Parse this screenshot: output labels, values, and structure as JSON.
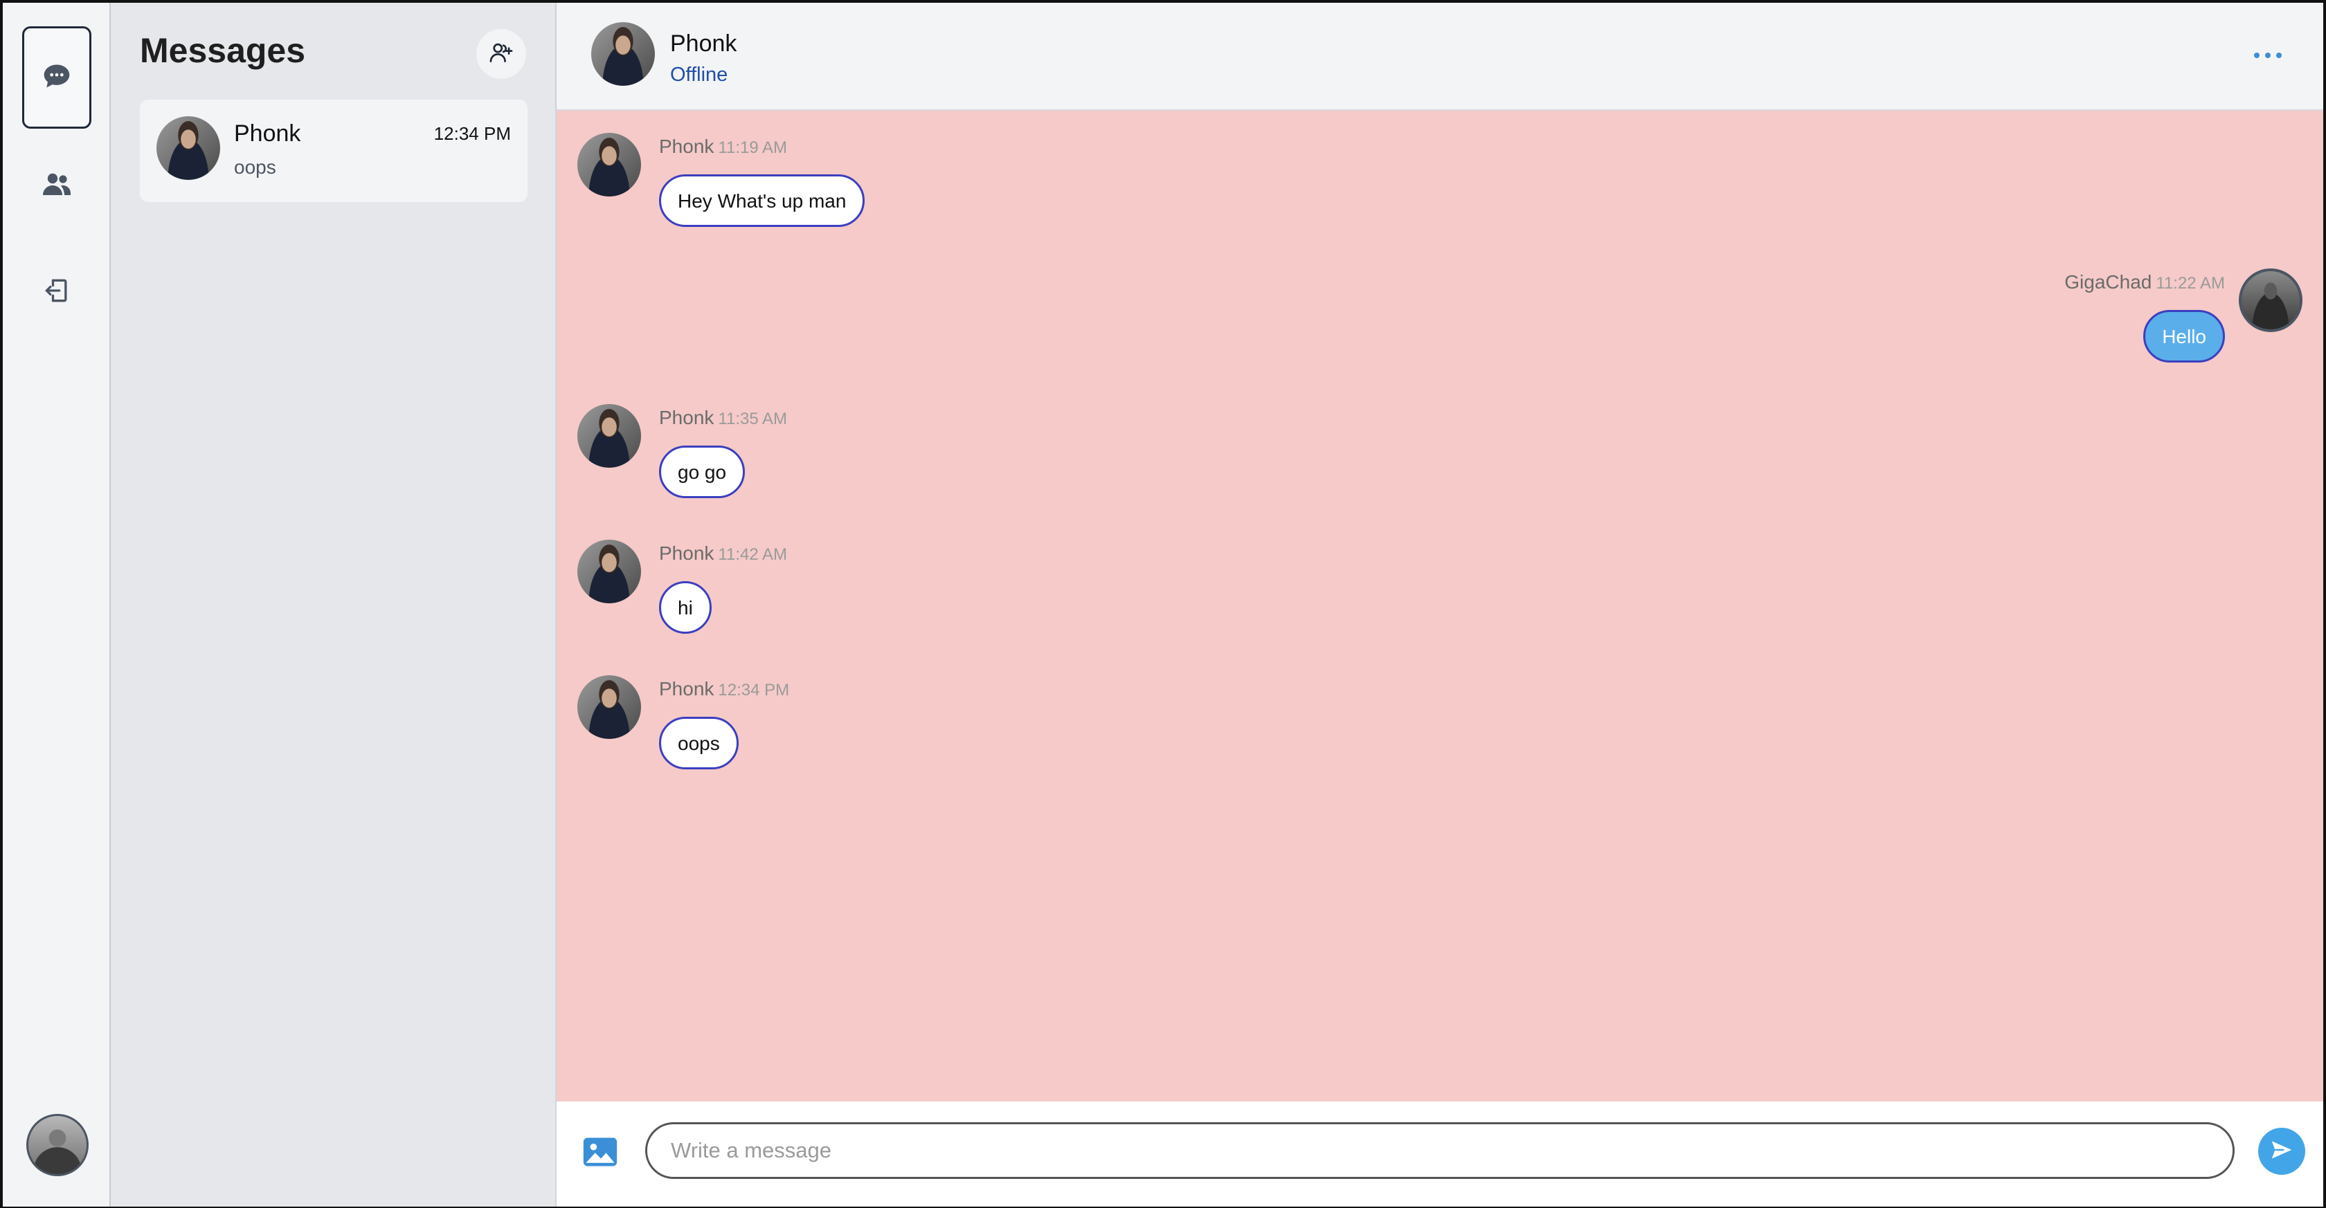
{
  "sidebar": {
    "icons": [
      "chat-bubble-icon",
      "users-icon",
      "logout-icon"
    ],
    "user_avatar": "GigaChad"
  },
  "conversations": {
    "title": "Messages",
    "add_icon": "add-user-icon",
    "items": [
      {
        "name": "Phonk",
        "time": "12:34 PM",
        "preview": "oops"
      }
    ]
  },
  "chat": {
    "header": {
      "name": "Phonk",
      "status": "Offline",
      "more_icon": "ellipsis-icon"
    },
    "messages": [
      {
        "sender": "Phonk",
        "time": "11:19 AM",
        "text": "Hey What's up man",
        "direction": "incoming"
      },
      {
        "sender": "GigaChad",
        "time": "11:22 AM",
        "text": "Hello",
        "direction": "outgoing"
      },
      {
        "sender": "Phonk",
        "time": "11:35 AM",
        "text": "go go",
        "direction": "incoming"
      },
      {
        "sender": "Phonk",
        "time": "11:42 AM",
        "text": "hi",
        "direction": "incoming"
      },
      {
        "sender": "Phonk",
        "time": "12:34 PM",
        "text": "oops",
        "direction": "incoming"
      }
    ],
    "composer": {
      "placeholder": "Write a message",
      "value": "",
      "image_icon": "image-icon",
      "send_icon": "send-icon"
    }
  },
  "colors": {
    "chat_background": "#f5cac8",
    "outgoing_bubble": "#5aaeea",
    "bubble_border": "#3b3fbf",
    "status_text": "#1e4fa8",
    "send_button": "#42a5e8"
  }
}
